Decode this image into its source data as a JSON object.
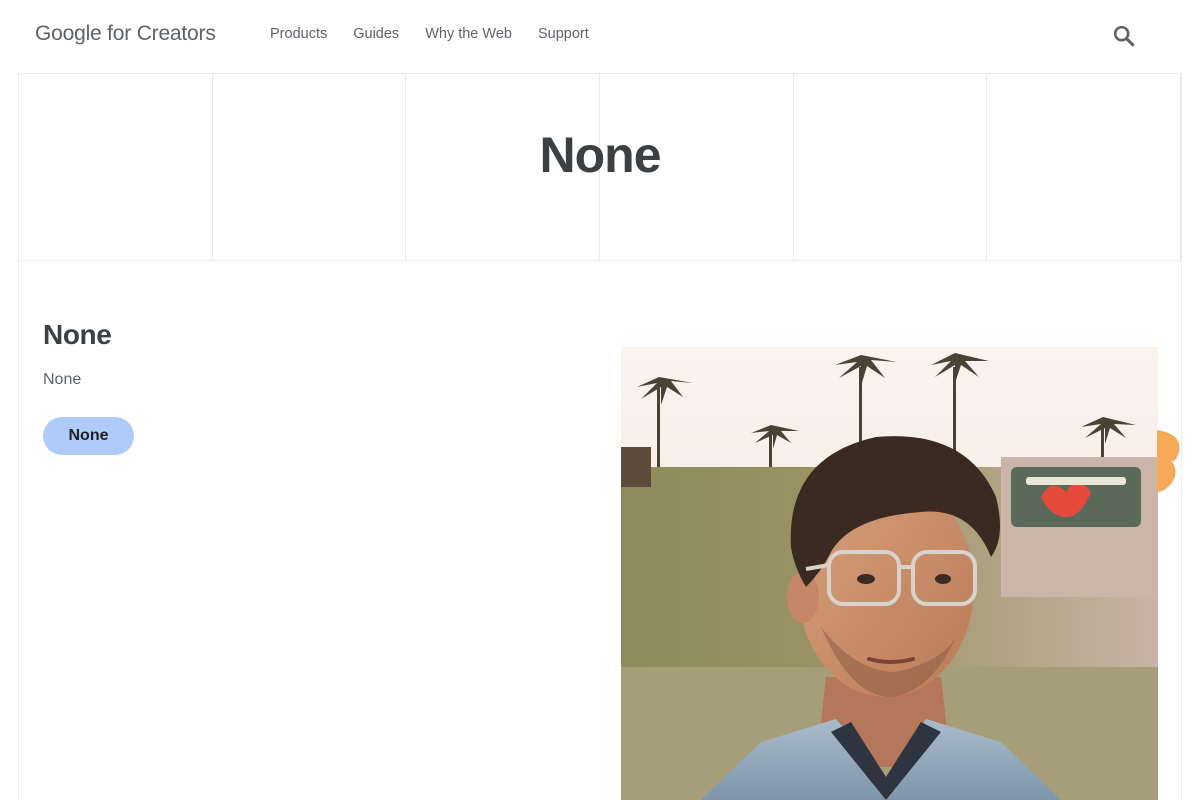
{
  "header": {
    "logo_text": "Google for Creators",
    "nav": [
      {
        "label": "Products"
      },
      {
        "label": "Guides"
      },
      {
        "label": "Why the Web"
      },
      {
        "label": "Support"
      }
    ],
    "search_icon": "search-icon"
  },
  "hero": {
    "title": "None"
  },
  "feature": {
    "title": "None",
    "description": "None",
    "button_label": "None",
    "image": "photo of man with clear-frame glasses and denim jacket, palm trees and neon sign behind"
  },
  "colors": {
    "button_bg": "#aecbfa",
    "text_dark": "#3c4043",
    "text_muted": "#5f6368",
    "border": "#e8eaed",
    "accent_orange": "#f7a95a"
  }
}
